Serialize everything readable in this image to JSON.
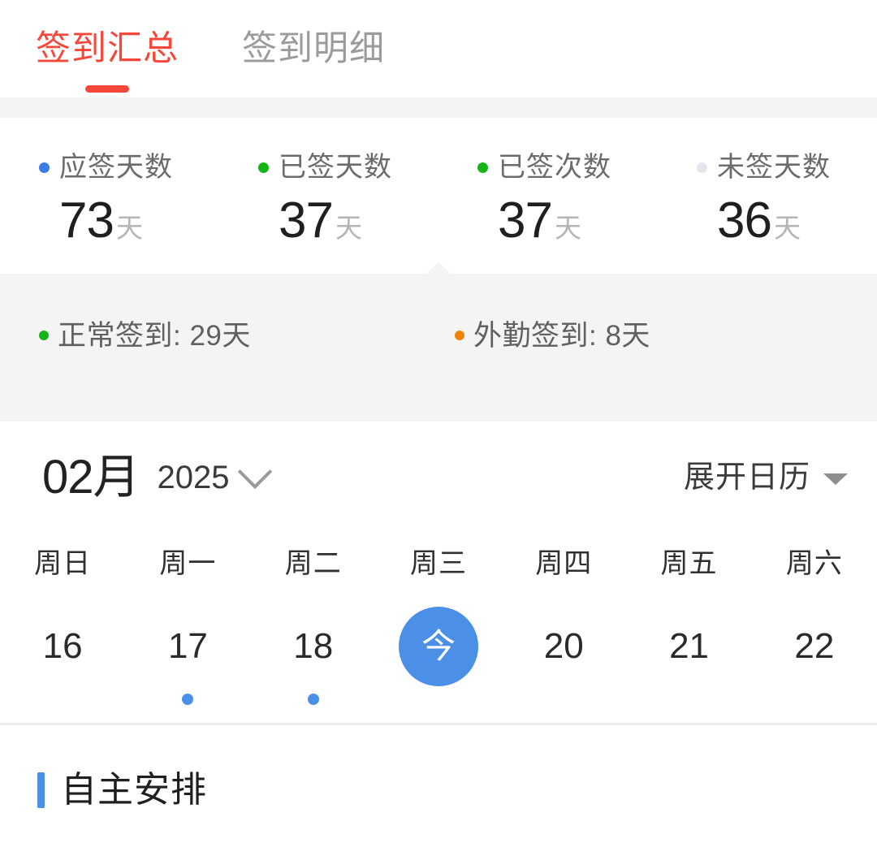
{
  "tabs": [
    {
      "label": "签到汇总",
      "active": true
    },
    {
      "label": "签到明细",
      "active": false
    }
  ],
  "colors": {
    "accent_red": "#f5483b",
    "accent_blue": "#4b90e6",
    "green": "#16b316",
    "orange": "#f08400",
    "gray_dot": "#e3e6ec"
  },
  "summary": {
    "stats": [
      {
        "label": "应签天数",
        "value": "73",
        "unit": "天",
        "dot_color": "#3d7ce6",
        "dot_name": "due-days-dot"
      },
      {
        "label": "已签天数",
        "value": "37",
        "unit": "天",
        "dot_color": "#16b316",
        "dot_name": "signed-days-dot"
      },
      {
        "label": "已签次数",
        "value": "37",
        "unit": "天",
        "dot_color": "#16b316",
        "dot_name": "signed-times-dot"
      },
      {
        "label": "未签天数",
        "value": "36",
        "unit": "天",
        "dot_color": "#e3e6ec",
        "dot_name": "unsigned-days-dot"
      }
    ],
    "details": [
      {
        "text": "正常签到: 29天",
        "dot_color": "#16b316",
        "dot_name": "normal-signin-dot"
      },
      {
        "text": "外勤签到: 8天",
        "dot_color": "#f08400",
        "dot_name": "field-signin-dot"
      }
    ]
  },
  "calendar": {
    "month": "02月",
    "year": "2025",
    "expand_label": "展开日历",
    "weekdays": [
      "周日",
      "周一",
      "周二",
      "周三",
      "周四",
      "周五",
      "周六"
    ],
    "days": [
      {
        "label": "16",
        "today": false,
        "has_dot": false
      },
      {
        "label": "17",
        "today": false,
        "has_dot": true
      },
      {
        "label": "18",
        "today": false,
        "has_dot": true
      },
      {
        "label": "今",
        "today": true,
        "has_dot": false
      },
      {
        "label": "20",
        "today": false,
        "has_dot": false
      },
      {
        "label": "21",
        "today": false,
        "has_dot": false
      },
      {
        "label": "22",
        "today": false,
        "has_dot": false
      }
    ]
  },
  "section": {
    "title": "自主安排"
  }
}
